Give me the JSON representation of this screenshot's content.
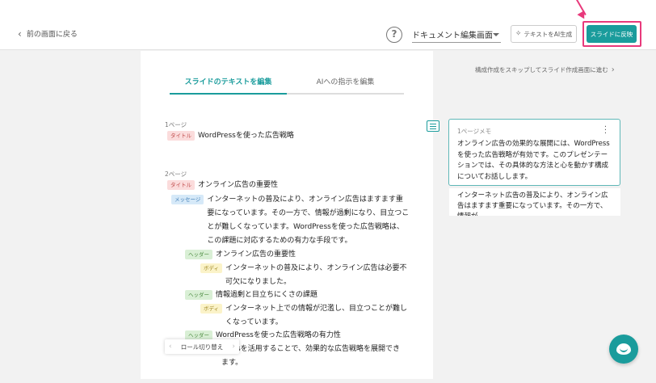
{
  "header": {
    "back_label": "前の画面に戻る",
    "help_symbol": "?",
    "view_select": "ドキュメント編集画面",
    "ai_button": "テキストをAI生成",
    "reflect_button": "スライドに反映",
    "annotation_color": "#e8397b"
  },
  "tabs": [
    {
      "label": "スライドのテキストを編集",
      "active": true
    },
    {
      "label": "AIへの指示を編集",
      "active": false
    }
  ],
  "pages": [
    {
      "label": "1ページ",
      "lines": [
        {
          "badge": "タイトル",
          "text": "WordPressを使った広告戦略"
        }
      ]
    },
    {
      "label": "2ページ",
      "lines": [
        {
          "badge": "タイトル",
          "text": "オンライン広告の重要性"
        },
        {
          "badge": "メッセージ",
          "text": "インターネットの普及により、オンライン広告はますます重要になっています。その一方で、情報が過剰になり、目立つことが難しくなっています。WordPressを使った広告戦略は、この課題に対応するための有力な手段です。"
        },
        {
          "badge": "ヘッダー",
          "text": "オンライン広告の重要性"
        },
        {
          "badge": "ボディ",
          "text": "インターネットの普及により、オンライン広告は必要不可欠になりました。"
        },
        {
          "badge": "ヘッダー",
          "text": "情報過剰と目立ちにくさの課題"
        },
        {
          "badge": "ボディ",
          "text": "インターネット上での情報が氾濫し、目立つことが難しくなっています。"
        },
        {
          "badge": "ヘッダー",
          "text": "WordPressを使った広告戦略の有力性"
        },
        {
          "badge": "ボディ",
          "text": "Pressを活用することで、効果的な広告戦略を展開できます。"
        }
      ]
    }
  ],
  "role_switch": "ロール切り替え",
  "sidebar": {
    "skip_link": "構成作成をスキップしてスライド作成画面に進む",
    "memo_title": "1ページメモ",
    "memo_text": "オンライン広告の効果的な展開には、WordPressを使った広告戦略が有効です。このプレゼンテーションでは、その具体的な方法と心を動かす構成についてお話しします。",
    "memo2_text": "インターネット広告の普及により、オンライン広告はますます重要になっています。その一方で、情報が…"
  },
  "colors": {
    "accent": "#1a9c9c",
    "title_badge": "#fbdcdc",
    "message_badge": "#d6e9f8",
    "header_badge": "#d9efd5",
    "body_badge": "#fbf3c9"
  }
}
